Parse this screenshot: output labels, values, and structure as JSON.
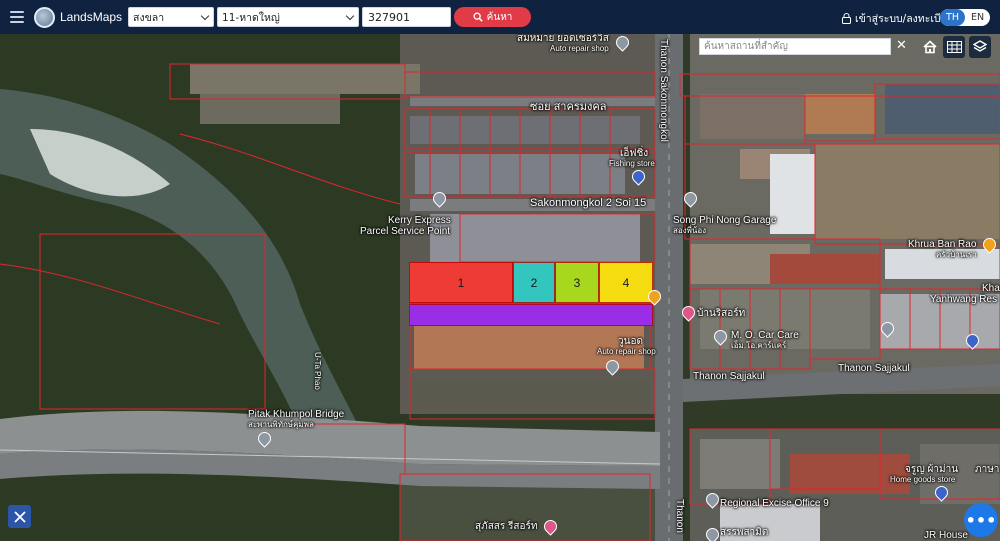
{
  "header": {
    "brand": "LandsMaps",
    "province": "สงขลา",
    "district": "11-หาดใหญ่",
    "parcel_number": "327901",
    "search_label": "ค้นหา",
    "login_label": "เข้าสู่ระบบ/ลงทะเบียน",
    "lang_th": "TH",
    "lang_en": "EN"
  },
  "map": {
    "place_search_placeholder": "ค้นหาสถานที่สำคัญ",
    "close_symbol": "✕",
    "plots": [
      {
        "label": "1",
        "color": "#ee3b36"
      },
      {
        "label": "2",
        "color": "#33c6be"
      },
      {
        "label": "3",
        "color": "#a8d81e"
      },
      {
        "label": "4",
        "color": "#f5dc10"
      }
    ],
    "strip_color": "#9a2ee6",
    "labels": {
      "auto_repair_top_th": "สมหมาย ยอดเซอร์วิส",
      "auto_repair_top_en": "Auto repair shop",
      "soi_th": "ซอย สาครมงคล",
      "fishing_th": "เอ็ฟชิ่ง",
      "fishing_en": "Fishing store",
      "road_sakon": "Thanon Sakonmongkol",
      "kerry_1": "Kerry Express",
      "kerry_2": "Parcel Service Point",
      "sakon_soi": "Sakonmongkol 2 Soi 15",
      "song_phi_nong": "Song Phi Nong Garage",
      "song_phi_nong_th": "สองพี่น้อง",
      "khrua": "Khrua Ban Rao",
      "khrua_th": "ครัวบ้านเรา",
      "kha": "Kha",
      "yanhwang": "Yanhwang Res",
      "banrisod": "บ้านริสอร์ท",
      "mo_car_care": "M. O. Car Care",
      "mo_car_care_th": "เอ็ม.โอ.คาร์แคร์",
      "auto_repair_bottom_th": "วูนอด",
      "auto_repair_bottom_en": "Auto repair shop",
      "sajjakul_1": "Thanon Sajjakul",
      "sajjakul_2": "Thanon Sajjakul",
      "u_ta_phao": "U-Ta Phao",
      "pitak_bridge": "Pitak Khumpol Bridge",
      "pitak_bridge_th": "สะพานพิทักษ์คุมพล",
      "home_goods_th": "จรูญ ผ้าม่าน",
      "home_goods_en": "Home goods store",
      "excise": "Regional Excise Office 9",
      "supasorn": "สุภัสสร รีสอร์ท",
      "road_thanon_bottom": "Thanon",
      "jr_house": "JR House",
      "excise_th": "สรรพสามิต",
      "khaya": "ภาษา"
    }
  }
}
